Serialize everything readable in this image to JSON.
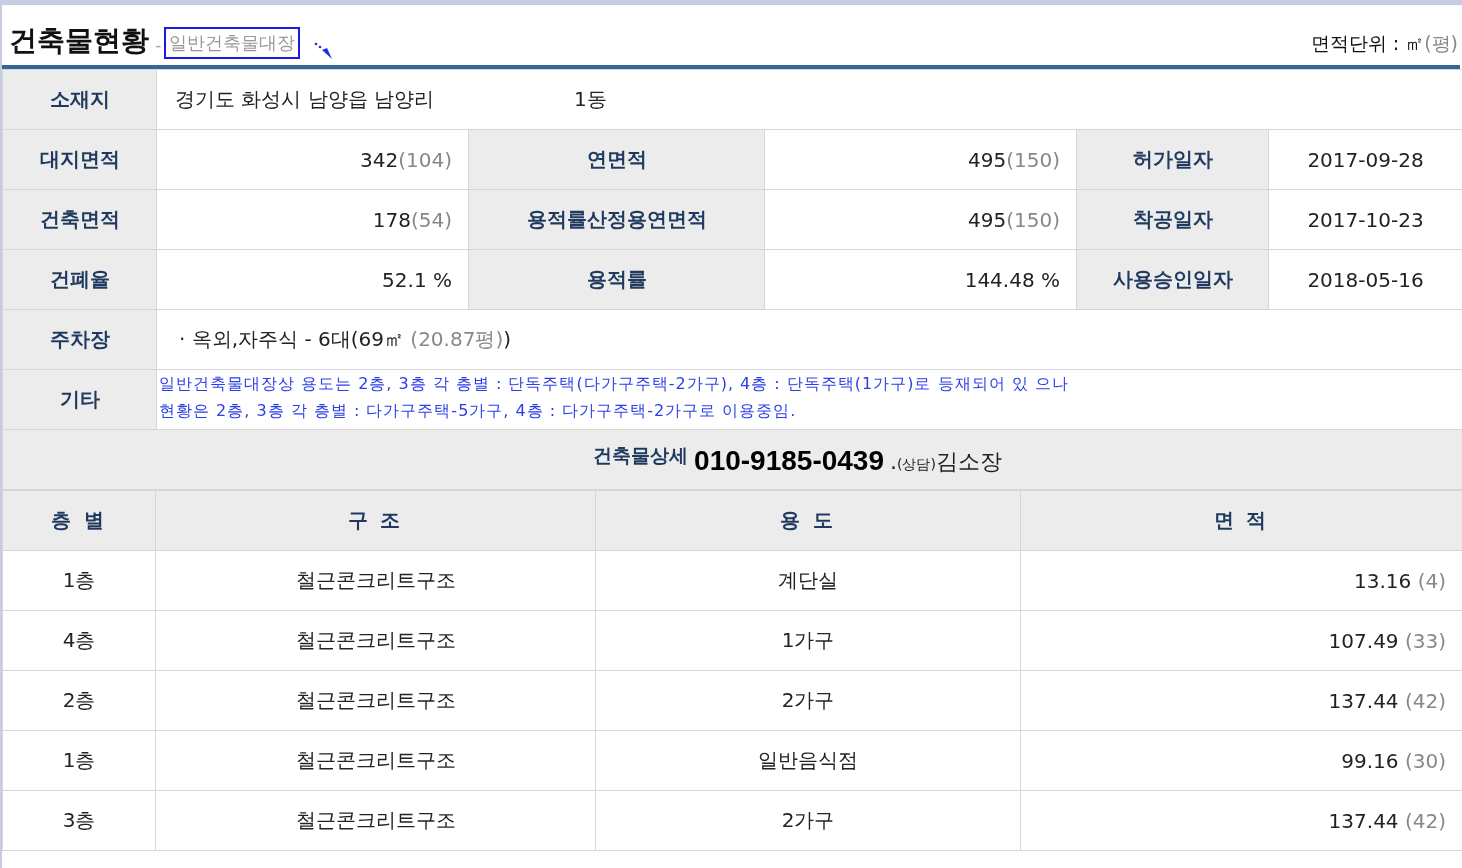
{
  "header": {
    "title": "건축물현황",
    "separator": "-",
    "subtitle": "일반건축물대장",
    "unit_label": "면적단위 : ㎡",
    "unit_pyeong": "(평)"
  },
  "location": {
    "label": "소재지",
    "address": "경기도 화성시 남양읍 남양리",
    "building": "1동"
  },
  "summary_rows": [
    [
      {
        "label": "대지면적",
        "value": "342",
        "pyeong": "(104)"
      },
      {
        "label": "연면적",
        "value": "495",
        "pyeong": "(150)"
      },
      {
        "label": "허가일자",
        "value": "2017-09-28"
      }
    ],
    [
      {
        "label": "건축면적",
        "value": "178",
        "pyeong": "(54)"
      },
      {
        "label": "용적률산정용연면적",
        "value": "495",
        "pyeong": "(150)"
      },
      {
        "label": "착공일자",
        "value": "2017-10-23"
      }
    ],
    [
      {
        "label": "건폐율",
        "value": "52.1 %"
      },
      {
        "label": "용적률",
        "value": "144.48 %"
      },
      {
        "label": "사용승인일자",
        "value": "2018-05-16"
      }
    ]
  ],
  "parking": {
    "label": "주차장",
    "value": "· 옥외,자주식 - 6대(69㎡",
    "pyeong": "(20.87평)",
    "close": ")"
  },
  "notes": {
    "label": "기타",
    "lines": [
      "일반건축물대장상  용도는 2층, 3층 각 층별 : 단독주택(다가구주택-2가구), 4층 : 단독주택(1가구)로 등재되어 있 으나",
      "현황은 2층, 3층 각 층별 : 다가구주택-5가구, 4층 : 다가구주택-2가구로 이용중임."
    ]
  },
  "detail": {
    "label": "건축물상세",
    "phone": "010-9185-0439",
    "dot": ".",
    "note": "(상담)",
    "name": "김소장"
  },
  "floors": {
    "columns": [
      "층 별",
      "구  조",
      "용  도",
      "면 적"
    ],
    "rows": [
      {
        "floor": "1층",
        "structure": "철근콘크리트구조",
        "use": "계단실",
        "area": "13.16",
        "pyeong": "(4)"
      },
      {
        "floor": "4층",
        "structure": "철근콘크리트구조",
        "use": "1가구",
        "area": "107.49",
        "pyeong": "(33)"
      },
      {
        "floor": "2층",
        "structure": "철근콘크리트구조",
        "use": "2가구",
        "area": "137.44",
        "pyeong": "(42)"
      },
      {
        "floor": "1층",
        "structure": "철근콘크리트구조",
        "use": "일반음식점",
        "area": "99.16",
        "pyeong": "(30)"
      },
      {
        "floor": "3층",
        "structure": "철근콘크리트구조",
        "use": "2가구",
        "area": "137.44",
        "pyeong": "(42)"
      }
    ]
  }
}
